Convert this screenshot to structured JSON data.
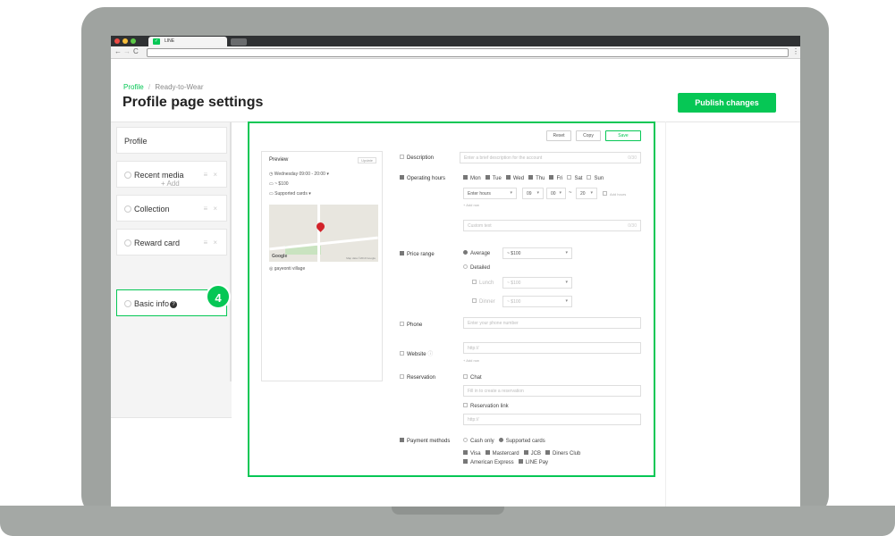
{
  "browser": {
    "tab_title": "LINE",
    "tab_icon": "line-logo-icon",
    "back_glyph": "←",
    "forward_glyph": "→",
    "reload_glyph": "C",
    "menu_glyph": "⋮"
  },
  "header": {
    "breadcrumb_link": "Profile",
    "breadcrumb_sep": "/",
    "breadcrumb_current": "Ready-to-Wear",
    "title": "Profile page settings",
    "publish_label": "Publish changes"
  },
  "sidebar": {
    "items": [
      {
        "label": "Profile"
      },
      {
        "label": "Recent media",
        "handle": "≡ ×"
      },
      {
        "label": "Collection",
        "handle": "≡ ×"
      },
      {
        "label": "Reward card",
        "handle": "≡ ×"
      },
      {
        "label": "Basic info"
      }
    ],
    "add_label": "+ Add",
    "step_badge": "4"
  },
  "toolbar": {
    "reset_label": "Reset",
    "copy_label": "Copy",
    "save_label": "Save"
  },
  "preview": {
    "title": "Preview",
    "update_label": "Update",
    "hours_line": "Wednesday  09:00 - 20:00 ▾",
    "price_line": "~ $100",
    "cards_line": "Supported cards ▾",
    "map_brand": "Google",
    "map_credit": "Map data ©2019 Google",
    "address_line": "gayeonti village"
  },
  "form": {
    "description": {
      "label": "Description",
      "placeholder": "Enter a brief description for the account",
      "count": "0/30"
    },
    "operating_hours": {
      "label": "Operating hours",
      "days": [
        "Mon",
        "Tue",
        "Wed",
        "Thu",
        "Fri",
        "Sat",
        "Sun"
      ],
      "days_checked": [
        true,
        true,
        true,
        true,
        true,
        false,
        false
      ],
      "time_type": "Enter hours",
      "start_hour": "09",
      "start_min": "00",
      "sep": "~",
      "end_hour": "20",
      "add_hours": "Add hours",
      "add_row": "+ Add row",
      "custom_placeholder": "Custom text",
      "custom_count": "0/30"
    },
    "price_range": {
      "label": "Price range",
      "average_label": "Average",
      "average_value": "~ $100",
      "detailed_label": "Detailed",
      "lunch_label": "Lunch",
      "lunch_value": "~ $100",
      "dinner_label": "Dinner",
      "dinner_value": "~ $100"
    },
    "phone": {
      "label": "Phone",
      "placeholder": "Enter your phone number"
    },
    "website": {
      "label": "Website",
      "placeholder": "http://",
      "add_row": "+ Add row"
    },
    "reservation": {
      "label": "Reservation",
      "chat_label": "Chat",
      "chat_placeholder": "Fill in to create a reservation",
      "link_label": "Reservation link",
      "link_placeholder": "http://"
    },
    "payment": {
      "label": "Payment methods",
      "cash_label": "Cash only",
      "cards_label": "Supported cards",
      "card_options": [
        "Visa",
        "Mastercard",
        "JCB",
        "Diners Club",
        "American Express",
        "LINE Pay"
      ]
    }
  },
  "colors": {
    "accent": "#06c755",
    "frame": "#9fa3a0"
  }
}
